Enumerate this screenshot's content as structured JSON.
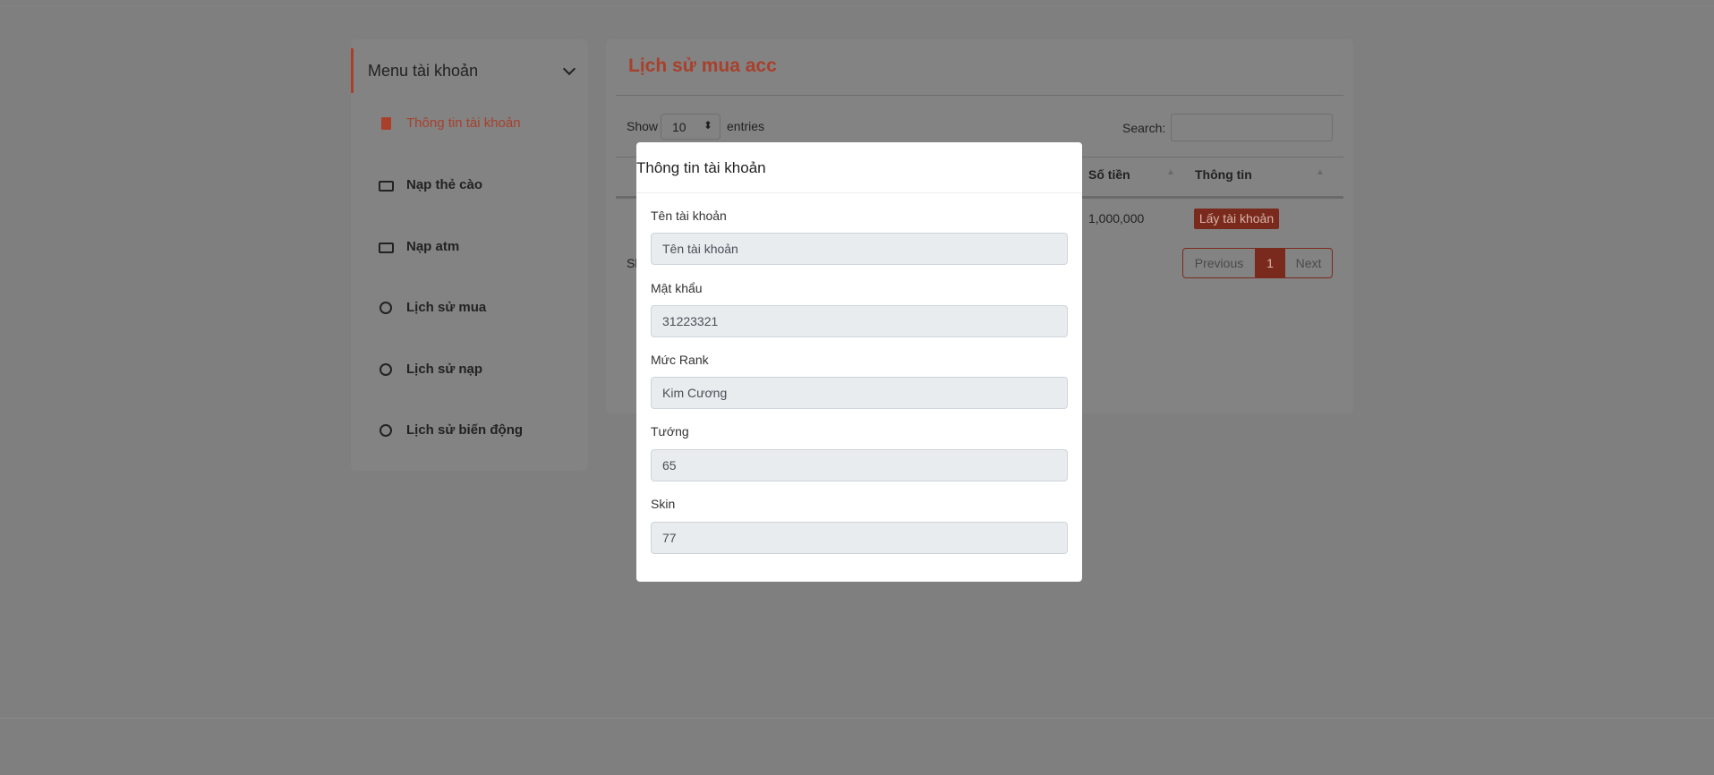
{
  "sidebar": {
    "header": "Menu tài khoản",
    "items": [
      {
        "label": "Thông tin tài khoản",
        "icon": "file-icon"
      },
      {
        "label": "Nạp thẻ cào",
        "icon": "money-icon"
      },
      {
        "label": "Nạp atm",
        "icon": "money-icon"
      },
      {
        "label": "Lịch sử mua",
        "icon": "clock-icon"
      },
      {
        "label": "Lịch sử nạp",
        "icon": "clock-icon"
      },
      {
        "label": "Lịch sử biến động",
        "icon": "clock-icon"
      }
    ]
  },
  "main": {
    "title": "Lịch sử mua acc",
    "show": "Show",
    "entries_value": "10",
    "entries": "entries",
    "search_label": "Search:",
    "columns": [
      "Số tiền",
      "Thông tin"
    ],
    "row": {
      "amount": "1,000,000",
      "action": "Lấy tài khoản"
    },
    "info_partial": "Sh",
    "pagination": {
      "previous": "Previous",
      "page": "1",
      "next": "Next"
    }
  },
  "modal": {
    "title": "Thông tin tài khoản",
    "fields": [
      {
        "label": "Tên tài khoản",
        "value": "Tên tài khoản"
      },
      {
        "label": "Mật khẩu",
        "value": "31223321"
      },
      {
        "label": "Mức Rank",
        "value": "Kim Cương"
      },
      {
        "label": "Tướng",
        "value": "65"
      },
      {
        "label": "Skin",
        "value": "77"
      }
    ]
  },
  "colors": {
    "accent": "#e74c3c",
    "overlay": "#7f7f7f"
  }
}
